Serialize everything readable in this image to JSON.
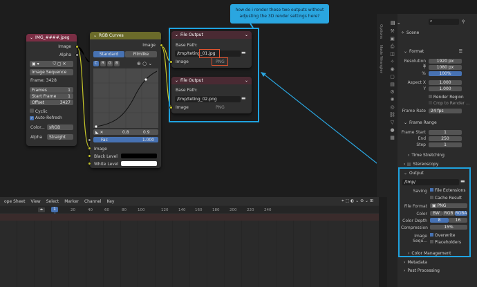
{
  "callout": {
    "line1": "how do i render these two outputs without",
    "line2": "adjusting the 3D render settings here?"
  },
  "img_node": {
    "title": "IMG_####.jpeg",
    "out_image": "Image",
    "out_alpha": "Alpha",
    "source": "Image Sequence",
    "frames_info": "Frame: 3428",
    "frames_label": "Frames",
    "frames_val": "1",
    "start_label": "Start Frame",
    "start_val": "1",
    "offset_label": "Offset",
    "offset_val": "3427",
    "cyclic": "Cyclic",
    "autorefresh": "Auto-Refresh",
    "color_label": "Color...",
    "color_val": "sRGB",
    "alpha_label": "Alpha",
    "alpha_val": "Straight"
  },
  "curves_node": {
    "title": "RGB Curves",
    "out_image": "Image",
    "tab_standard": "Standard",
    "tab_filmlike": "Filmlike",
    "ch_c": "C",
    "ch_r": "R",
    "ch_g": "G",
    "ch_b": "B",
    "x_val": "0.8",
    "y_val": "0.9",
    "fac_label": "Fac",
    "fac_val": "1.000",
    "in_image": "Image",
    "black": "Black Level",
    "white": "White Level"
  },
  "out1": {
    "title": "File Output",
    "base_label": "Base Path:",
    "path": "/tmp/teting_01.jpg",
    "format": "PNG",
    "in_image": "Image"
  },
  "out2": {
    "title": "File Output",
    "base_label": "Base Path:",
    "path": "/tmp/teting_02.png",
    "format": "PNG",
    "in_image": "Image"
  },
  "side_tabs": {
    "options": "Options",
    "wrangler": "Node Wrangler"
  },
  "timeline": {
    "editor": "ope Sheet",
    "menu": [
      "View",
      "Select",
      "Marker",
      "Channel",
      "Key"
    ],
    "current": "1",
    "ticks": [
      "20",
      "40",
      "60",
      "80",
      "100",
      "120",
      "140",
      "160",
      "180",
      "200",
      "220",
      "240"
    ]
  },
  "props": {
    "scene_label": "Scene",
    "format_head": "Format",
    "res_x_label": "Resolution X",
    "res_x": "1920 px",
    "res_y_label": "Y",
    "res_y": "1080 px",
    "pct_label": "%",
    "pct": "100%",
    "aspect_x_label": "Aspect X",
    "aspect_x": "1.000",
    "aspect_y_label": "Y",
    "aspect_y": "1.000",
    "render_region": "Render Region",
    "crop": "Crop to Render ...",
    "frame_rate_label": "Frame Rate",
    "frame_rate": "24 fps",
    "frame_range_head": "Frame Range",
    "fstart_label": "Frame Start",
    "fstart": "1",
    "fend_label": "End",
    "fend": "250",
    "fstep_label": "Step",
    "fstep": "1",
    "time_stretch": "Time Stretching",
    "stereo": "Stereoscopy",
    "output_head": "Output",
    "out_path": "/tmp/",
    "saving_label": "Saving",
    "file_ext": "File Extensions",
    "cache": "Cache Result",
    "file_format_label": "File Format",
    "file_format": "PNG",
    "color_label": "Color",
    "bw": "BW",
    "rgb": "RGB",
    "rgba": "RGBA",
    "depth_label": "Color Depth",
    "d8": "8",
    "d16": "16",
    "compression_label": "Compression",
    "compression": "15%",
    "imgseq_label": "Image Sequ...",
    "overwrite": "Overwrite",
    "placeholders": "Placeholders",
    "color_mgmt": "Color Management",
    "metadata": "Metadata",
    "post": "Post Processing"
  },
  "colors": {
    "accent": "#4772b3",
    "highlight": "#1fa3e0",
    "red_box": "#e0532f",
    "img_header": "#7a2e44",
    "curves_header": "#6b6b2a",
    "out_header": "#4a2a33"
  }
}
